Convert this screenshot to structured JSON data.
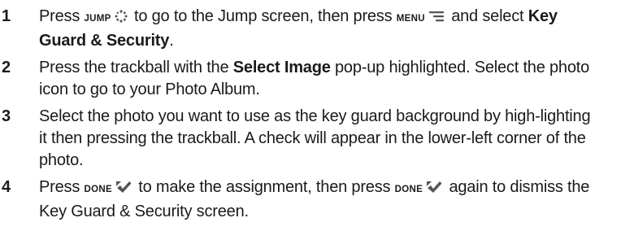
{
  "steps": [
    {
      "number": "1",
      "parts": {
        "t1": "Press ",
        "key1": "JUMP",
        "t2": " to go to the Jump screen, then press ",
        "key2": "MENU",
        "t3": " and select ",
        "bold1": "Key Guard & Security",
        "t4": "."
      },
      "icons": [
        "jump-icon",
        "menu-icon"
      ]
    },
    {
      "number": "2",
      "parts": {
        "t1": "Press the trackball with the ",
        "bold1": "Select Image",
        "t2": " pop-up highlighted. Select the photo icon to go to your Photo Album."
      }
    },
    {
      "number": "3",
      "parts": {
        "t1": "Select the photo you want to use as the key guard background by high-lighting it then pressing the trackball. A check will appear in the lower-left corner of the photo."
      }
    },
    {
      "number": "4",
      "parts": {
        "t1": "Press ",
        "key1": "DONE",
        "t2": " to make the assignment, then press ",
        "key2": "DONE",
        "t3": " again to dismiss the Key Guard & Security screen."
      },
      "icons": [
        "done-check-icon",
        "done-check-icon"
      ]
    }
  ],
  "colors": {
    "text": "#1a1a1a",
    "icon": "#555555"
  }
}
